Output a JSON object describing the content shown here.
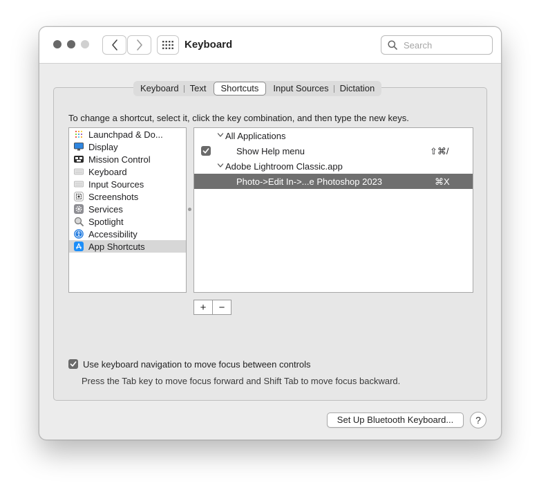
{
  "window": {
    "title": "Keyboard"
  },
  "search": {
    "placeholder": "Search"
  },
  "tabs": [
    {
      "label": "Keyboard"
    },
    {
      "label": "Text"
    },
    {
      "label": "Shortcuts",
      "active": true
    },
    {
      "label": "Input Sources"
    },
    {
      "label": "Dictation"
    }
  ],
  "instructions": "To change a shortcut, select it, click the key combination, and then type the new keys.",
  "sidebar": {
    "items": [
      {
        "label": "Launchpad & Do...",
        "icon": "launchpad-icon"
      },
      {
        "label": "Display",
        "icon": "display-icon"
      },
      {
        "label": "Mission Control",
        "icon": "mission-control-icon"
      },
      {
        "label": "Keyboard",
        "icon": "keyboard-icon"
      },
      {
        "label": "Input Sources",
        "icon": "input-sources-icon"
      },
      {
        "label": "Screenshots",
        "icon": "screenshots-icon"
      },
      {
        "label": "Services",
        "icon": "services-gear-icon"
      },
      {
        "label": "Spotlight",
        "icon": "spotlight-icon"
      },
      {
        "label": "Accessibility",
        "icon": "accessibility-icon"
      },
      {
        "label": "App Shortcuts",
        "icon": "app-store-icon",
        "selected": true
      }
    ]
  },
  "shortcuts": {
    "groups": [
      {
        "label": "All Applications",
        "items": [
          {
            "label": "Show Help menu",
            "key": "⇧⌘/",
            "checked": true
          }
        ]
      },
      {
        "label": "Adobe Lightroom Classic.app",
        "items": [
          {
            "label": "Photo->Edit In->...e Photoshop 2023",
            "key": "⌘X",
            "selected": true
          }
        ]
      }
    ]
  },
  "buttons": {
    "add": "+",
    "remove": "−",
    "bluetooth": "Set Up Bluetooth Keyboard...",
    "help": "?"
  },
  "keyboard_nav": {
    "label": "Use keyboard navigation to move focus between controls",
    "checked": true,
    "note": "Press the Tab key to move focus forward and Shift Tab to move focus backward."
  },
  "colors": {
    "selected_row": "#6f6f6f",
    "sidebar_selected": "#d7d7d7"
  }
}
